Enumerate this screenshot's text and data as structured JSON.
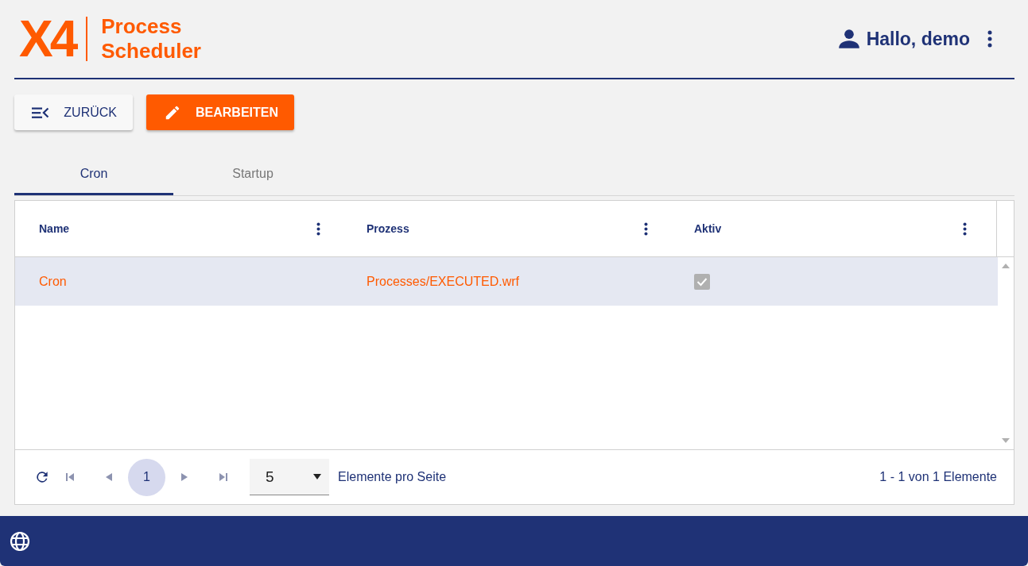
{
  "logo": {
    "mark": "X4",
    "title_lines": [
      "Process",
      "Scheduler"
    ]
  },
  "user": {
    "greeting": "Hallo, demo"
  },
  "buttons": [
    {
      "kind": "back",
      "label": "ZURÜCK"
    },
    {
      "kind": "edit",
      "label": "BEARBEITEN"
    }
  ],
  "tabs": [
    {
      "label": "Cron",
      "selected": true
    },
    {
      "label": "Startup",
      "selected": false
    }
  ],
  "table": {
    "columns": [
      "Name",
      "Prozess",
      "Aktiv"
    ],
    "rows": [
      {
        "name": "Cron",
        "process": "Processes/EXECUTED.wrf",
        "active": true,
        "selected": true
      }
    ]
  },
  "pager": {
    "page": "1",
    "page_size": "5",
    "page_size_label": "Elemente pro Seite",
    "summary": "1 - 1 von 1 Elemente"
  }
}
